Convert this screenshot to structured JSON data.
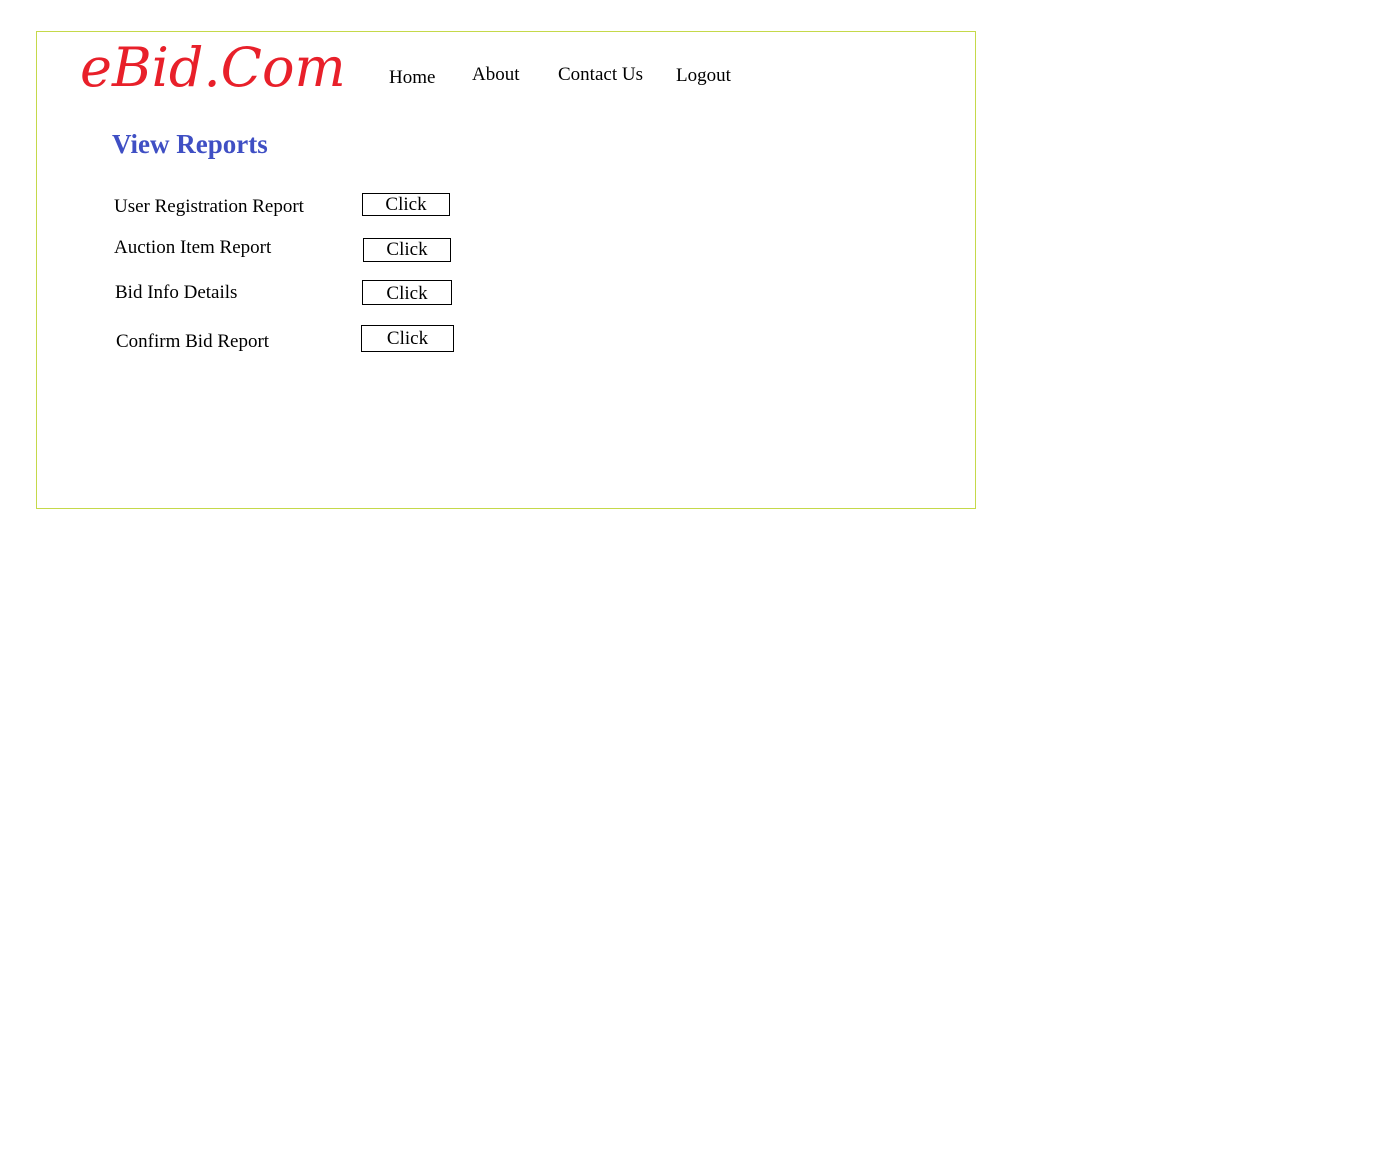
{
  "header": {
    "logo_text": "eBid.Com",
    "logo_color": "#e8202a",
    "frame_border_color": "#c5d94a"
  },
  "nav": {
    "items": [
      {
        "label": "Home"
      },
      {
        "label": "About"
      },
      {
        "label": "Contact Us"
      },
      {
        "label": "Logout"
      }
    ]
  },
  "main": {
    "title": "View Reports",
    "title_color": "#3f4fc4",
    "reports": [
      {
        "label": "User Registration Report",
        "button_label": "Click"
      },
      {
        "label": "Auction Item Report",
        "button_label": "Click"
      },
      {
        "label": "Bid Info Details",
        "button_label": "Click"
      },
      {
        "label": "Confirm Bid Report",
        "button_label": "Click"
      }
    ]
  }
}
